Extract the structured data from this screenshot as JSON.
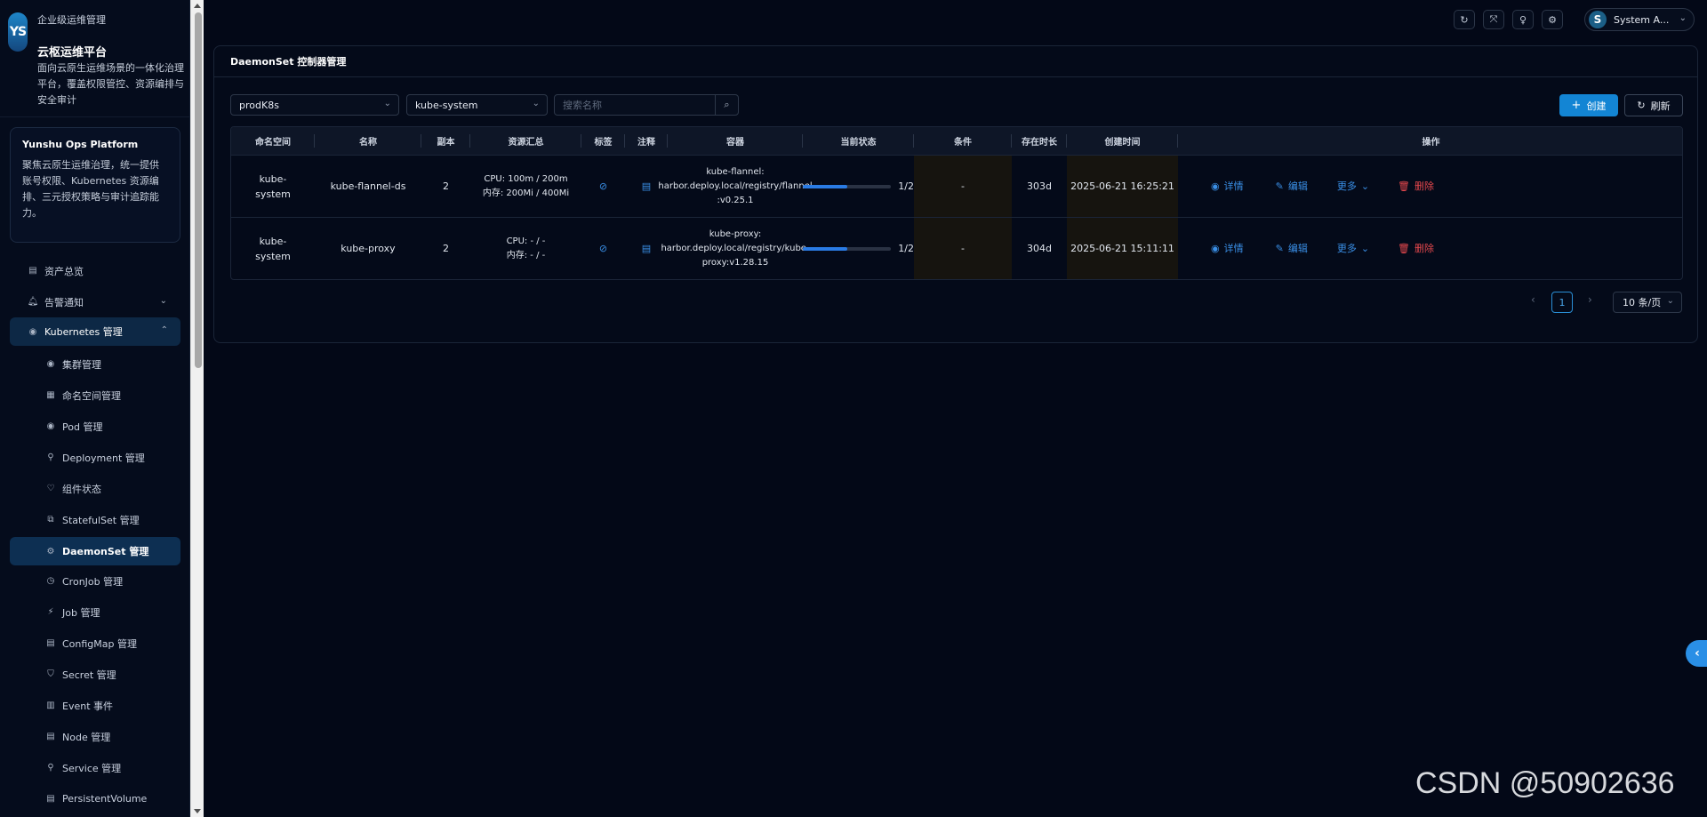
{
  "brand": {
    "logo": "YS",
    "subtitle": "企业级运维管理",
    "title": "云枢运维平台",
    "description": "面向云原生运维场景的一体化治理平台，覆盖权限管控、资源编排与安全审计"
  },
  "platform_card": {
    "title": "Yunshu Ops Platform",
    "description": "聚焦云原生运维治理，统一提供账号权限、Kubernetes 资源编排、三元授权策略与审计追踪能力。"
  },
  "menu": {
    "assets": "资产总览",
    "alerts": "告警通知",
    "kubernetes": "Kubernetes 管理",
    "sub_items": [
      {
        "icon": "◉",
        "label": "集群管理"
      },
      {
        "icon": "▦",
        "label": "命名空间管理"
      },
      {
        "icon": "◉",
        "label": "Pod 管理"
      },
      {
        "icon": "⚲",
        "label": "Deployment 管理"
      },
      {
        "icon": "♡",
        "label": "组件状态"
      },
      {
        "icon": "⧉",
        "label": "StatefulSet 管理"
      },
      {
        "icon": "⚙",
        "label": "DaemonSet 管理"
      },
      {
        "icon": "◷",
        "label": "CronJob 管理"
      },
      {
        "icon": "⚡",
        "label": "Job 管理"
      },
      {
        "icon": "▤",
        "label": "ConfigMap 管理"
      },
      {
        "icon": "⛉",
        "label": "Secret 管理"
      },
      {
        "icon": "▥",
        "label": "Event 事件"
      },
      {
        "icon": "▤",
        "label": "Node 管理"
      },
      {
        "icon": "⚲",
        "label": "Service 管理"
      },
      {
        "icon": "▤",
        "label": "PersistentVolume"
      }
    ]
  },
  "user": {
    "avatar": "S",
    "name": "System A..."
  },
  "card": {
    "title": "DaemonSet 控制器管理"
  },
  "filters": {
    "cluster": "prodK8s",
    "namespace": "kube-system",
    "search_placeholder": "搜索名称",
    "create": "创建",
    "refresh": "刷新"
  },
  "table": {
    "columns": [
      "命名空间",
      "名称",
      "副本",
      "资源汇总",
      "标签",
      "注释",
      "容器",
      "当前状态",
      "条件",
      "存在时长",
      "创建时间",
      "操作"
    ],
    "rows": [
      {
        "namespace_l1": "kube-",
        "namespace_l2": "system",
        "name": "kube-flannel-ds",
        "replicas": "2",
        "cpu": "CPU: 100m / 200m",
        "mem": "内存: 200Mi / 400Mi",
        "container_l1": "kube-flannel:",
        "container_l2": "harbor.deploy.local/registry/flannel",
        "container_l3": ":v0.25.1",
        "status": "1/2",
        "status_ratio": 0.5,
        "condition": "-",
        "age": "303d",
        "created": "2025-06-21 16:25:21"
      },
      {
        "namespace_l1": "kube-",
        "namespace_l2": "system",
        "name": "kube-proxy",
        "replicas": "2",
        "cpu": "CPU: - / -",
        "mem": "内存: - / -",
        "container_l1": "kube-proxy:",
        "container_l2": "harbor.deploy.local/registry/kube-",
        "container_l3": "proxy:v1.28.15",
        "status": "1/2",
        "status_ratio": 0.5,
        "condition": "-",
        "age": "304d",
        "created": "2025-06-21 15:11:11"
      }
    ],
    "actions": {
      "detail": "详情",
      "edit": "编辑",
      "more": "更多",
      "delete": "删除"
    }
  },
  "pagination": {
    "page": "1",
    "page_size": "10 条/页"
  },
  "watermark": "CSDN @50902636"
}
